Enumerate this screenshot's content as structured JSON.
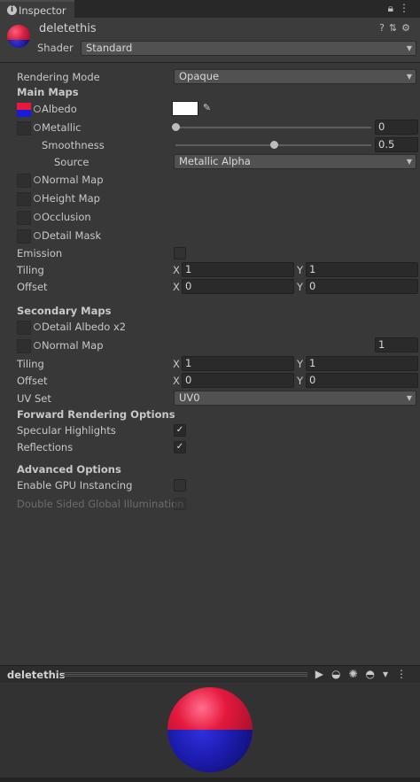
{
  "tab": {
    "title": "Inspector"
  },
  "material": {
    "name": "deletethis",
    "shader_label": "Shader",
    "shader_value": "Standard"
  },
  "rendering_mode": {
    "label": "Rendering Mode",
    "value": "Opaque"
  },
  "main_maps": {
    "header": "Main Maps",
    "albedo": {
      "label": "Albedo",
      "color": "#ffffff"
    },
    "metallic": {
      "label": "Metallic",
      "value": "0",
      "level": 0.0
    },
    "smoothness": {
      "label": "Smoothness",
      "value": "0.5",
      "level": 0.5
    },
    "source": {
      "label": "Source",
      "value": "Metallic Alpha"
    },
    "normal_map": {
      "label": "Normal Map"
    },
    "height_map": {
      "label": "Height Map"
    },
    "occlusion": {
      "label": "Occlusion"
    },
    "detail_mask": {
      "label": "Detail Mask"
    },
    "emission": {
      "label": "Emission"
    },
    "tiling": {
      "label": "Tiling",
      "x": "1",
      "y": "1"
    },
    "offset": {
      "label": "Offset",
      "x": "0",
      "y": "0"
    }
  },
  "secondary_maps": {
    "header": "Secondary Maps",
    "detail_albedo": {
      "label": "Detail Albedo x2"
    },
    "normal_map": {
      "label": "Normal Map",
      "value": "1"
    },
    "tiling": {
      "label": "Tiling",
      "x": "1",
      "y": "1"
    },
    "offset": {
      "label": "Offset",
      "x": "0",
      "y": "0"
    },
    "uv_set": {
      "label": "UV Set",
      "value": "UV0"
    }
  },
  "forward_rendering": {
    "header": "Forward Rendering Options",
    "specular_highlights": {
      "label": "Specular Highlights",
      "checked": true
    },
    "reflections": {
      "label": "Reflections",
      "checked": true
    }
  },
  "advanced": {
    "header": "Advanced Options",
    "gpu_instancing": {
      "label": "Enable GPU Instancing",
      "checked": false
    },
    "double_sided_gi": {
      "label": "Double Sided Global Illumination",
      "checked": false
    }
  },
  "axis": {
    "x": "X",
    "y": "Y"
  },
  "preview": {
    "name": "deletethis"
  },
  "colors": {
    "bg": "#383838",
    "field": "#2a2a2a",
    "albedo_red": "#e8193c",
    "albedo_blue": "#1a1adc"
  }
}
